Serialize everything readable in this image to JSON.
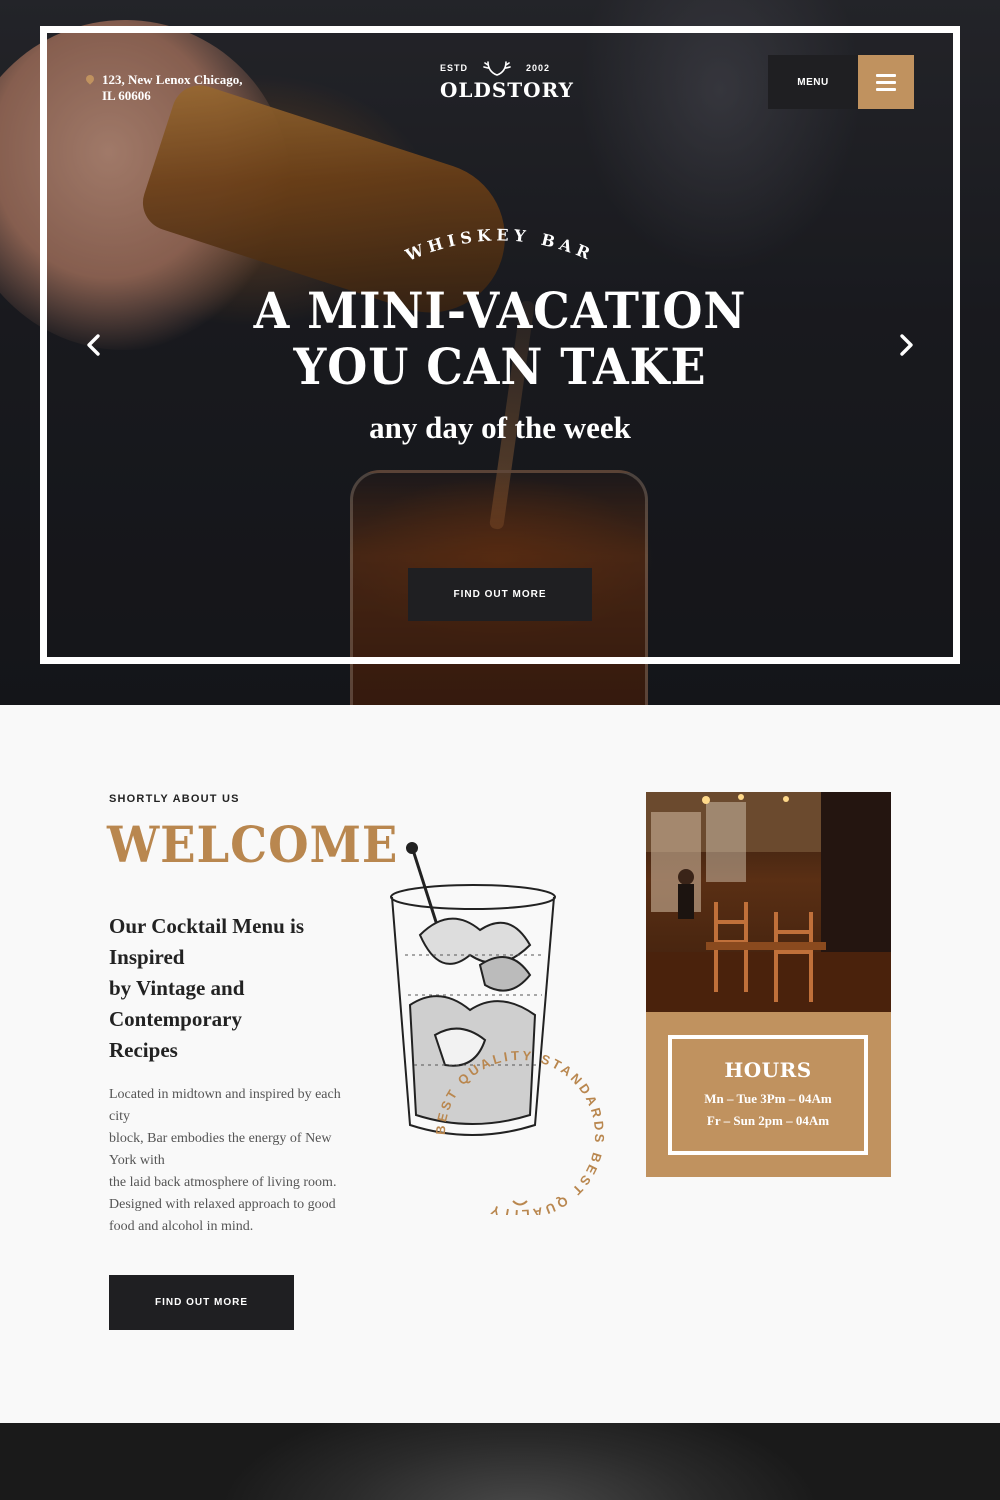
{
  "header": {
    "address_line1": "123, New Lenox Chicago,",
    "address_line2": "IL 60606",
    "logo_estd": "ESTD",
    "logo_year": "2002",
    "logo_name": "OLDSTORY",
    "menu_label": "MENU"
  },
  "hero": {
    "eyebrow": "WHISKEY BAR",
    "headline_line1": "A MINI-VACATION",
    "headline_line2": "YOU CAN TAKE",
    "subhead": "any day of the week",
    "button": "FIND OUT MORE"
  },
  "about": {
    "eyebrow": "SHORTLY ABOUT US",
    "title": "WELCOME",
    "subtitle_lines": [
      "Our Cocktail Menu is",
      "Inspired",
      "by Vintage and",
      "Contemporary",
      "Recipes"
    ],
    "text_lines": [
      "Located in midtown and inspired by each",
      "city",
      "block, Bar embodies the energy of New",
      "York with",
      "the laid back atmosphere of living room.",
      "Designed with relaxed approach to good",
      "food and alcohol in mind."
    ],
    "button": "FIND OUT MORE",
    "badge_text": "BEST QUALITY STANDARDS BEST QUALITY",
    "hours": {
      "title": "HOURS",
      "line1": "Mn – Tue 3Pm – 04Am",
      "line2": "Fr – Sun 2pm – 04Am"
    }
  },
  "colors": {
    "accent": "#c0925f",
    "dark": "#1f1f22",
    "title_gold": "#b9874f"
  },
  "icons": {
    "menu": "hamburger-icon",
    "prev": "chevron-left-icon",
    "next": "chevron-right-icon",
    "location": "map-pin-icon",
    "logo": "antler-icon"
  }
}
